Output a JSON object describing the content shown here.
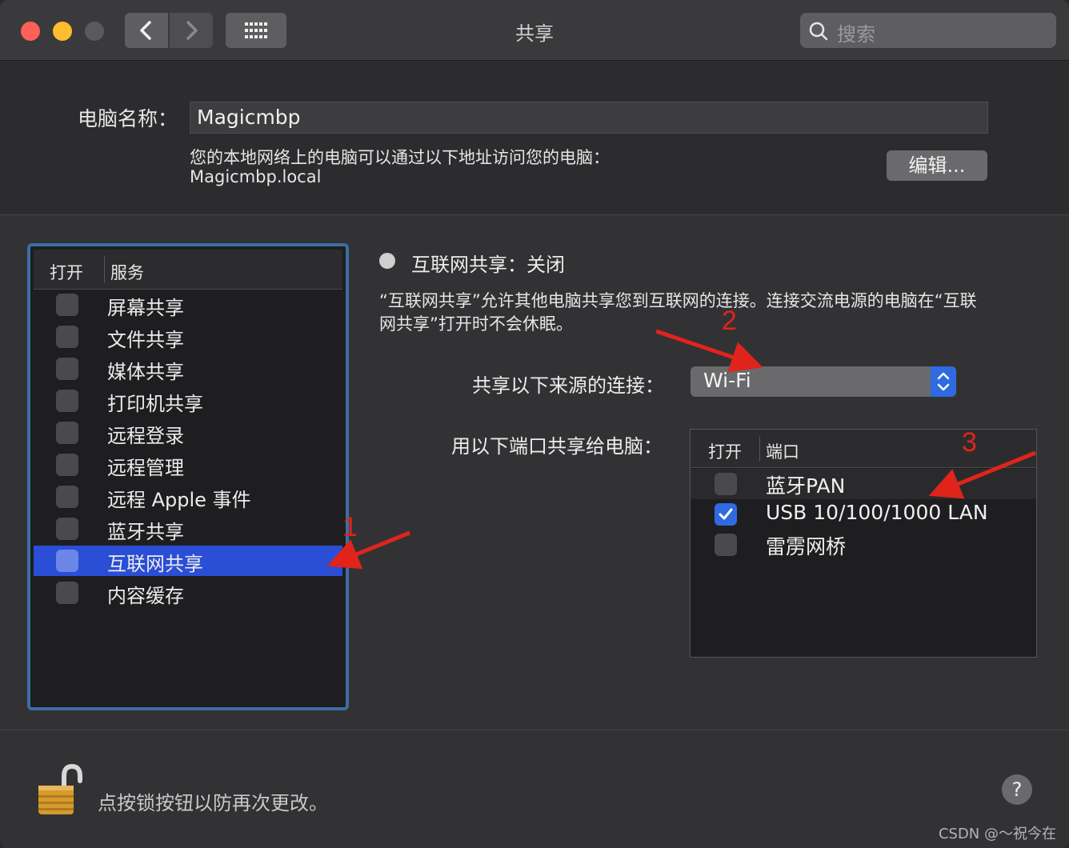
{
  "window": {
    "title": "共享"
  },
  "search": {
    "placeholder": "搜索"
  },
  "computer_name": {
    "label": "电脑名称：",
    "value": "Magicmbp",
    "info_line1": "您的本地网络上的电脑可以通过以下地址访问您的电脑：",
    "info_line2": "Magicmbp.local",
    "edit_button": "编辑..."
  },
  "services": {
    "header_on": "打开",
    "header_service": "服务",
    "items": [
      {
        "label": "屏幕共享",
        "checked": false,
        "selected": false
      },
      {
        "label": "文件共享",
        "checked": false,
        "selected": false
      },
      {
        "label": "媒体共享",
        "checked": false,
        "selected": false
      },
      {
        "label": "打印机共享",
        "checked": false,
        "selected": false
      },
      {
        "label": "远程登录",
        "checked": false,
        "selected": false
      },
      {
        "label": "远程管理",
        "checked": false,
        "selected": false
      },
      {
        "label": "远程 Apple 事件",
        "checked": false,
        "selected": false
      },
      {
        "label": "蓝牙共享",
        "checked": false,
        "selected": false
      },
      {
        "label": "互联网共享",
        "checked": false,
        "selected": true
      },
      {
        "label": "内容缓存",
        "checked": false,
        "selected": false
      }
    ]
  },
  "detail": {
    "status": "互联网共享：关闭",
    "description_line1": "“互联网共享”允许其他电脑共享您到互联网的连接。连接交流电源的电脑在“互联",
    "description_line2": "网共享”打开时不会休眠。",
    "share_from_label": "共享以下来源的连接：",
    "share_from_value": "Wi-Fi",
    "to_ports_label": "用以下端口共享给电脑：",
    "ports_header_on": "打开",
    "ports_header_port": "端口",
    "ports": [
      {
        "label": "蓝牙PAN",
        "checked": false
      },
      {
        "label": "USB 10/100/1000 LAN",
        "checked": true
      },
      {
        "label": "雷雳网桥",
        "checked": false
      }
    ]
  },
  "footer": {
    "lock_text": "点按锁按钮以防再次更改。",
    "help": "?"
  },
  "annotations": {
    "n1": "1",
    "n2": "2",
    "n3": "3",
    "color": "#e0241b"
  },
  "watermark": "CSDN @～祝今在"
}
